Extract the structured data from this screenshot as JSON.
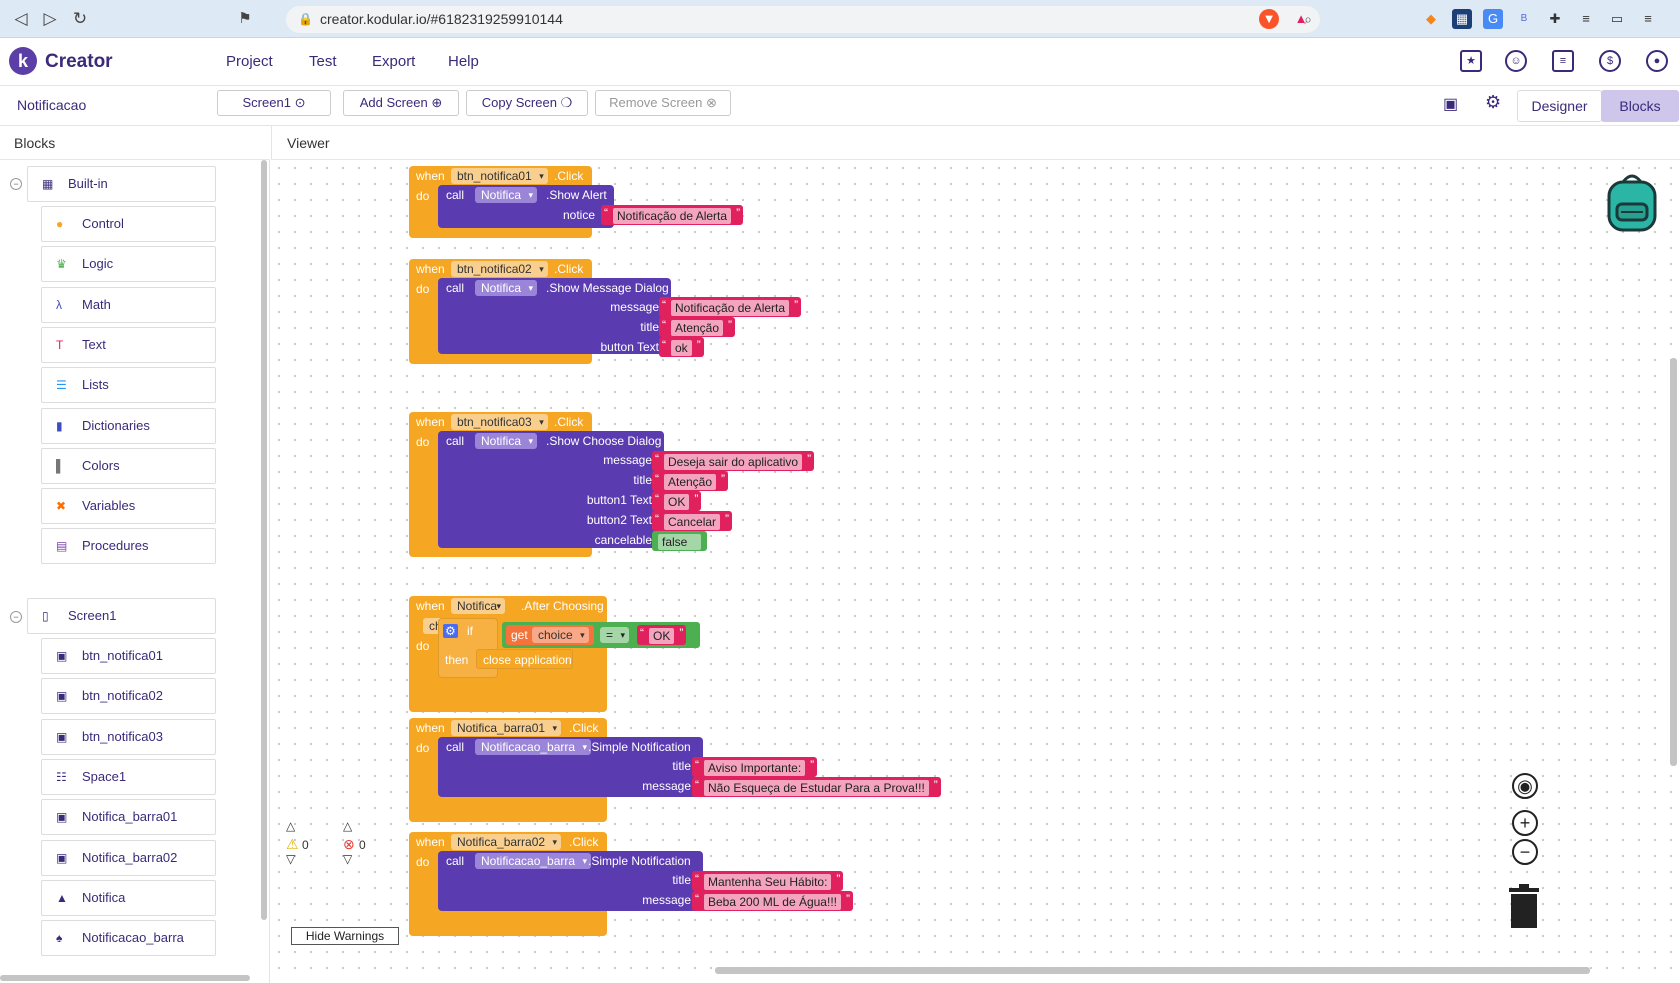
{
  "browser": {
    "url": "creator.kodular.io/#6182319259910144",
    "nav": [
      "◁",
      "▷",
      "↻"
    ]
  },
  "app": {
    "name": "Creator",
    "logo_letter": "k",
    "menu": [
      "Project",
      "Test",
      "Export",
      "Help"
    ]
  },
  "toolbar": {
    "project_name": "Notificacao",
    "screen_select": "Screen1",
    "add_screen": "Add Screen",
    "copy_screen": "Copy Screen",
    "remove_screen": "Remove Screen",
    "designer": "Designer",
    "blocks": "Blocks"
  },
  "panels": {
    "blocks": "Blocks",
    "viewer": "Viewer"
  },
  "sidebar": {
    "builtin": "Built-in",
    "builtin_items": [
      {
        "label": "Control",
        "icon": "control-icon",
        "color": "#f5a623"
      },
      {
        "label": "Logic",
        "icon": "logic-icon",
        "color": "#4caf50"
      },
      {
        "label": "Math",
        "icon": "math-icon",
        "color": "#3f51b5"
      },
      {
        "label": "Text",
        "icon": "text-icon",
        "color": "#e0215e"
      },
      {
        "label": "Lists",
        "icon": "lists-icon",
        "color": "#2196f3"
      },
      {
        "label": "Dictionaries",
        "icon": "dictionaries-icon",
        "color": "#3b4dbf"
      },
      {
        "label": "Colors",
        "icon": "colors-icon",
        "color": "#777777"
      },
      {
        "label": "Variables",
        "icon": "variables-icon",
        "color": "#ff6d00"
      },
      {
        "label": "Procedures",
        "icon": "procedures-icon",
        "color": "#7b3fa8"
      }
    ],
    "screen": "Screen1",
    "screen_items": [
      {
        "label": "btn_notifica01",
        "icon": "button-icon"
      },
      {
        "label": "btn_notifica02",
        "icon": "button-icon"
      },
      {
        "label": "btn_notifica03",
        "icon": "button-icon"
      },
      {
        "label": "Space1",
        "icon": "space-icon"
      },
      {
        "label": "Notifica_barra01",
        "icon": "button-icon"
      },
      {
        "label": "Notifica_barra02",
        "icon": "button-icon"
      },
      {
        "label": "Notifica",
        "icon": "bell-icon"
      },
      {
        "label": "Notificacao_barra",
        "icon": "bell-ring-icon"
      }
    ]
  },
  "blocks": {
    "kw": {
      "when": "when",
      "do": "do",
      "call": "call",
      "if": "if",
      "then": "then",
      "get": "get"
    },
    "b1": {
      "comp": "btn_notifica01",
      "event": ".Click",
      "target": "Notifica",
      "method": ".Show Alert",
      "args": [
        "notice"
      ],
      "values": [
        "Notificação de Alerta"
      ]
    },
    "b2": {
      "comp": "btn_notifica02",
      "event": ".Click",
      "target": "Notifica",
      "method": ".Show Message Dialog",
      "args": [
        "message",
        "title",
        "button Text"
      ],
      "values": [
        "Notificação de Alerta",
        "Atenção",
        "ok"
      ]
    },
    "b3": {
      "comp": "btn_notifica03",
      "event": ".Click",
      "target": "Notifica",
      "method": ".Show Choose Dialog",
      "args": [
        "message",
        "title",
        "button1 Text",
        "button2 Text",
        "cancelable"
      ],
      "values": [
        "Deseja sair do aplicativo",
        "Atenção",
        "OK",
        "Cancelar",
        "false"
      ]
    },
    "b4": {
      "comp": "Notifica",
      "event": ".After Choosing",
      "param": "choice",
      "get_var": "choice",
      "op": "=",
      "compare": "OK",
      "action": "close application"
    },
    "b5": {
      "comp": "Notifica_barra01",
      "event": ".Click",
      "target": "Notificacao_barra",
      "method": ".Simple Notification",
      "args": [
        "title",
        "message"
      ],
      "values": [
        "Aviso Importante:",
        "Não Esqueça de Estudar Para a Prova!!!"
      ]
    },
    "b6": {
      "comp": "Notifica_barra02",
      "event": ".Click",
      "target": "Notificacao_barra",
      "method": ".Simple Notification",
      "args": [
        "title",
        "message"
      ],
      "values": [
        "Mantenha Seu Hábito:",
        "Beba 200 ML de Água!!!"
      ]
    }
  },
  "warnings": {
    "warn_count": "0",
    "error_count": "0",
    "hide_label": "Hide Warnings"
  },
  "colors": {
    "event": "#f5a623",
    "call": "#5a3bb0",
    "text": "#e0215e",
    "logic": "#4caf50",
    "brand": "#3b2a7a"
  }
}
